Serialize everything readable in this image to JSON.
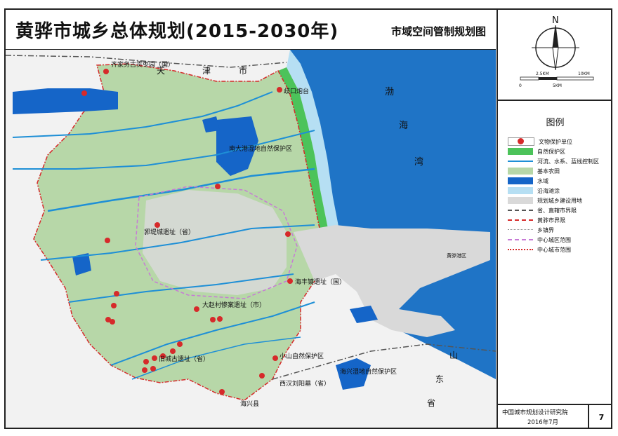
{
  "header": {
    "title": "黄骅市城乡总体规划(2015-2030年)",
    "subtitle": "市域空间管制规划图"
  },
  "compass": {
    "north_label": "N",
    "scale_top": [
      "2.5KM",
      "10KM"
    ],
    "scale_bottom": [
      "0",
      "5KM"
    ]
  },
  "legend": {
    "title": "图例",
    "items": [
      {
        "label": "文物保护单位",
        "icon": "red-dot-icon"
      },
      {
        "label": "自然保护区",
        "color": "#4cc35a"
      },
      {
        "label": "河流、水系、蓝线控制区",
        "color": "#1e8fd6"
      },
      {
        "label": "基本农田",
        "color": "#b7d7a8"
      },
      {
        "label": "水域",
        "color": "#1565c8"
      },
      {
        "label": "沿海滩涂",
        "color": "#b6dff3"
      },
      {
        "label": "规划城乡建设用地",
        "color": "#d9d9d9"
      },
      {
        "label": "省、直辖市界限",
        "color": "#555555"
      },
      {
        "label": "黄骅市界限",
        "color": "#d62a2a"
      },
      {
        "label": "乡镇界",
        "color": "#8a8a8a"
      },
      {
        "label": "中心城区范围",
        "color": "#c77ad6"
      },
      {
        "label": "中心城市范围",
        "color": "#d62a2a"
      }
    ]
  },
  "map": {
    "region_labels": {
      "tianjin": [
        "天",
        "津",
        "市"
      ],
      "bohai_bay": [
        "渤",
        "海",
        "湾"
      ],
      "shandong": [
        "山",
        "东",
        "省"
      ]
    },
    "site_labels": [
      "齐家务古贡枣园（国）",
      "歧口炮台",
      "南大港湿地自然保护区",
      "郛堤城遗址（省）",
      "海丰镇遗址（国）",
      "大赵村惨案遗址（市）",
      "旧城古遗址（省）",
      "小山自然保护区",
      "海兴湿地自然保护区",
      "西汉刘阳墓（省）",
      "海兴县",
      "黄骅港区"
    ]
  },
  "footer": {
    "org": "中国城市规划设计研究院",
    "date": "2016年7月",
    "page": "7"
  }
}
